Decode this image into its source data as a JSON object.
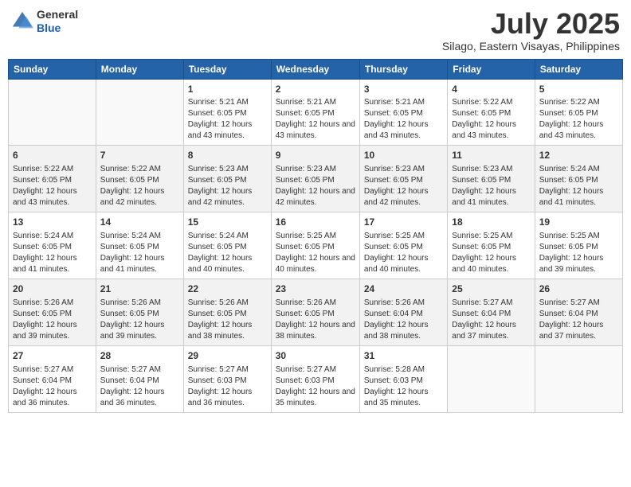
{
  "header": {
    "logo": {
      "general": "General",
      "blue": "Blue"
    },
    "title": "July 2025",
    "location": "Silago, Eastern Visayas, Philippines"
  },
  "weekdays": [
    "Sunday",
    "Monday",
    "Tuesday",
    "Wednesday",
    "Thursday",
    "Friday",
    "Saturday"
  ],
  "weeks": [
    [
      {
        "day": "",
        "sunrise": "",
        "sunset": "",
        "daylight": ""
      },
      {
        "day": "",
        "sunrise": "",
        "sunset": "",
        "daylight": ""
      },
      {
        "day": "1",
        "sunrise": "Sunrise: 5:21 AM",
        "sunset": "Sunset: 6:05 PM",
        "daylight": "Daylight: 12 hours and 43 minutes."
      },
      {
        "day": "2",
        "sunrise": "Sunrise: 5:21 AM",
        "sunset": "Sunset: 6:05 PM",
        "daylight": "Daylight: 12 hours and 43 minutes."
      },
      {
        "day": "3",
        "sunrise": "Sunrise: 5:21 AM",
        "sunset": "Sunset: 6:05 PM",
        "daylight": "Daylight: 12 hours and 43 minutes."
      },
      {
        "day": "4",
        "sunrise": "Sunrise: 5:22 AM",
        "sunset": "Sunset: 6:05 PM",
        "daylight": "Daylight: 12 hours and 43 minutes."
      },
      {
        "day": "5",
        "sunrise": "Sunrise: 5:22 AM",
        "sunset": "Sunset: 6:05 PM",
        "daylight": "Daylight: 12 hours and 43 minutes."
      }
    ],
    [
      {
        "day": "6",
        "sunrise": "Sunrise: 5:22 AM",
        "sunset": "Sunset: 6:05 PM",
        "daylight": "Daylight: 12 hours and 43 minutes."
      },
      {
        "day": "7",
        "sunrise": "Sunrise: 5:22 AM",
        "sunset": "Sunset: 6:05 PM",
        "daylight": "Daylight: 12 hours and 42 minutes."
      },
      {
        "day": "8",
        "sunrise": "Sunrise: 5:23 AM",
        "sunset": "Sunset: 6:05 PM",
        "daylight": "Daylight: 12 hours and 42 minutes."
      },
      {
        "day": "9",
        "sunrise": "Sunrise: 5:23 AM",
        "sunset": "Sunset: 6:05 PM",
        "daylight": "Daylight: 12 hours and 42 minutes."
      },
      {
        "day": "10",
        "sunrise": "Sunrise: 5:23 AM",
        "sunset": "Sunset: 6:05 PM",
        "daylight": "Daylight: 12 hours and 42 minutes."
      },
      {
        "day": "11",
        "sunrise": "Sunrise: 5:23 AM",
        "sunset": "Sunset: 6:05 PM",
        "daylight": "Daylight: 12 hours and 41 minutes."
      },
      {
        "day": "12",
        "sunrise": "Sunrise: 5:24 AM",
        "sunset": "Sunset: 6:05 PM",
        "daylight": "Daylight: 12 hours and 41 minutes."
      }
    ],
    [
      {
        "day": "13",
        "sunrise": "Sunrise: 5:24 AM",
        "sunset": "Sunset: 6:05 PM",
        "daylight": "Daylight: 12 hours and 41 minutes."
      },
      {
        "day": "14",
        "sunrise": "Sunrise: 5:24 AM",
        "sunset": "Sunset: 6:05 PM",
        "daylight": "Daylight: 12 hours and 41 minutes."
      },
      {
        "day": "15",
        "sunrise": "Sunrise: 5:24 AM",
        "sunset": "Sunset: 6:05 PM",
        "daylight": "Daylight: 12 hours and 40 minutes."
      },
      {
        "day": "16",
        "sunrise": "Sunrise: 5:25 AM",
        "sunset": "Sunset: 6:05 PM",
        "daylight": "Daylight: 12 hours and 40 minutes."
      },
      {
        "day": "17",
        "sunrise": "Sunrise: 5:25 AM",
        "sunset": "Sunset: 6:05 PM",
        "daylight": "Daylight: 12 hours and 40 minutes."
      },
      {
        "day": "18",
        "sunrise": "Sunrise: 5:25 AM",
        "sunset": "Sunset: 6:05 PM",
        "daylight": "Daylight: 12 hours and 40 minutes."
      },
      {
        "day": "19",
        "sunrise": "Sunrise: 5:25 AM",
        "sunset": "Sunset: 6:05 PM",
        "daylight": "Daylight: 12 hours and 39 minutes."
      }
    ],
    [
      {
        "day": "20",
        "sunrise": "Sunrise: 5:26 AM",
        "sunset": "Sunset: 6:05 PM",
        "daylight": "Daylight: 12 hours and 39 minutes."
      },
      {
        "day": "21",
        "sunrise": "Sunrise: 5:26 AM",
        "sunset": "Sunset: 6:05 PM",
        "daylight": "Daylight: 12 hours and 39 minutes."
      },
      {
        "day": "22",
        "sunrise": "Sunrise: 5:26 AM",
        "sunset": "Sunset: 6:05 PM",
        "daylight": "Daylight: 12 hours and 38 minutes."
      },
      {
        "day": "23",
        "sunrise": "Sunrise: 5:26 AM",
        "sunset": "Sunset: 6:05 PM",
        "daylight": "Daylight: 12 hours and 38 minutes."
      },
      {
        "day": "24",
        "sunrise": "Sunrise: 5:26 AM",
        "sunset": "Sunset: 6:04 PM",
        "daylight": "Daylight: 12 hours and 38 minutes."
      },
      {
        "day": "25",
        "sunrise": "Sunrise: 5:27 AM",
        "sunset": "Sunset: 6:04 PM",
        "daylight": "Daylight: 12 hours and 37 minutes."
      },
      {
        "day": "26",
        "sunrise": "Sunrise: 5:27 AM",
        "sunset": "Sunset: 6:04 PM",
        "daylight": "Daylight: 12 hours and 37 minutes."
      }
    ],
    [
      {
        "day": "27",
        "sunrise": "Sunrise: 5:27 AM",
        "sunset": "Sunset: 6:04 PM",
        "daylight": "Daylight: 12 hours and 36 minutes."
      },
      {
        "day": "28",
        "sunrise": "Sunrise: 5:27 AM",
        "sunset": "Sunset: 6:04 PM",
        "daylight": "Daylight: 12 hours and 36 minutes."
      },
      {
        "day": "29",
        "sunrise": "Sunrise: 5:27 AM",
        "sunset": "Sunset: 6:03 PM",
        "daylight": "Daylight: 12 hours and 36 minutes."
      },
      {
        "day": "30",
        "sunrise": "Sunrise: 5:27 AM",
        "sunset": "Sunset: 6:03 PM",
        "daylight": "Daylight: 12 hours and 35 minutes."
      },
      {
        "day": "31",
        "sunrise": "Sunrise: 5:28 AM",
        "sunset": "Sunset: 6:03 PM",
        "daylight": "Daylight: 12 hours and 35 minutes."
      },
      {
        "day": "",
        "sunrise": "",
        "sunset": "",
        "daylight": ""
      },
      {
        "day": "",
        "sunrise": "",
        "sunset": "",
        "daylight": ""
      }
    ]
  ]
}
